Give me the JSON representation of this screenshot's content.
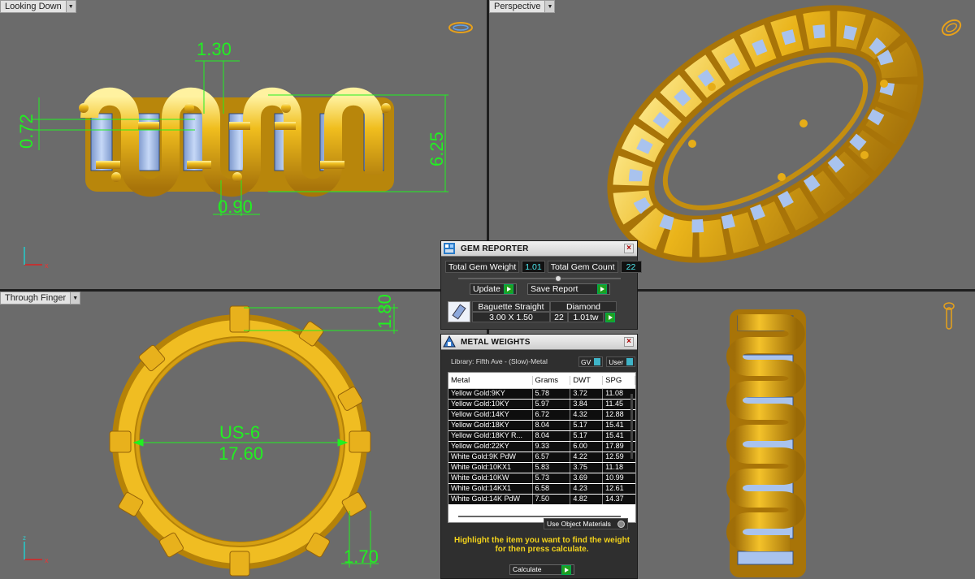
{
  "viewports": {
    "top_left": {
      "label": "Looking Down"
    },
    "top_right": {
      "label": "Perspective"
    },
    "bottom_left": {
      "label": "Through Finger"
    }
  },
  "dimensions": {
    "d130": "1.30",
    "d072": "0.72",
    "d625": "6.25",
    "d090": "0.90",
    "d180": "1.80",
    "d170": "1.70",
    "size_label": "US-6",
    "size_value": "17.60"
  },
  "gem_reporter": {
    "title": "GEM REPORTER",
    "total_weight_label": "Total Gem Weight",
    "total_weight_value": "1.01",
    "total_count_label": "Total Gem Count",
    "total_count_value": "22",
    "update_label": "Update",
    "save_label": "Save Report",
    "gem_shape": "Baguette Straight",
    "gem_size": "3.00 X 1.50",
    "gem_material": "Diamond",
    "gem_count": "22",
    "gem_weight": "1.01tw"
  },
  "metal_weights": {
    "title": "METAL WEIGHTS",
    "library": "Library: Fifth Ave - (Slow)-Metal",
    "gv_label": "GV",
    "user_label": "User",
    "columns": [
      "Metal",
      "Grams",
      "DWT",
      "SPG"
    ],
    "rows": [
      [
        "Yellow Gold:9KY",
        "5.78",
        "3.72",
        "11.08"
      ],
      [
        "Yellow Gold:10KY",
        "5.97",
        "3.84",
        "11.45"
      ],
      [
        "Yellow Gold:14KY",
        "6.72",
        "4.32",
        "12.88"
      ],
      [
        "Yellow Gold:18KY",
        "8.04",
        "5.17",
        "15.41"
      ],
      [
        "Yellow Gold:18KY R...",
        "8.04",
        "5.17",
        "15.41"
      ],
      [
        "Yellow Gold:22KY",
        "9.33",
        "6.00",
        "17.89"
      ],
      [
        "White Gold:9K PdW",
        "6.57",
        "4.22",
        "12.59"
      ],
      [
        "White Gold:10KX1",
        "5.83",
        "3.75",
        "11.18"
      ],
      [
        "White Gold:10KW",
        "5.73",
        "3.69",
        "10.99"
      ],
      [
        "White Gold:14KX1",
        "6.58",
        "4.23",
        "12.61"
      ],
      [
        "White Gold:14K PdW",
        "7.50",
        "4.82",
        "14.37"
      ]
    ],
    "use_object_materials": "Use Object Materials",
    "hint": "Highlight the item you want to find the weight for then press calculate.",
    "calculate_label": "Calculate"
  },
  "colors": {
    "viewport_bg": "#6b6b6b",
    "gold": "#e7b219",
    "gem": "#a9c3ee",
    "dimension": "#21f021"
  }
}
